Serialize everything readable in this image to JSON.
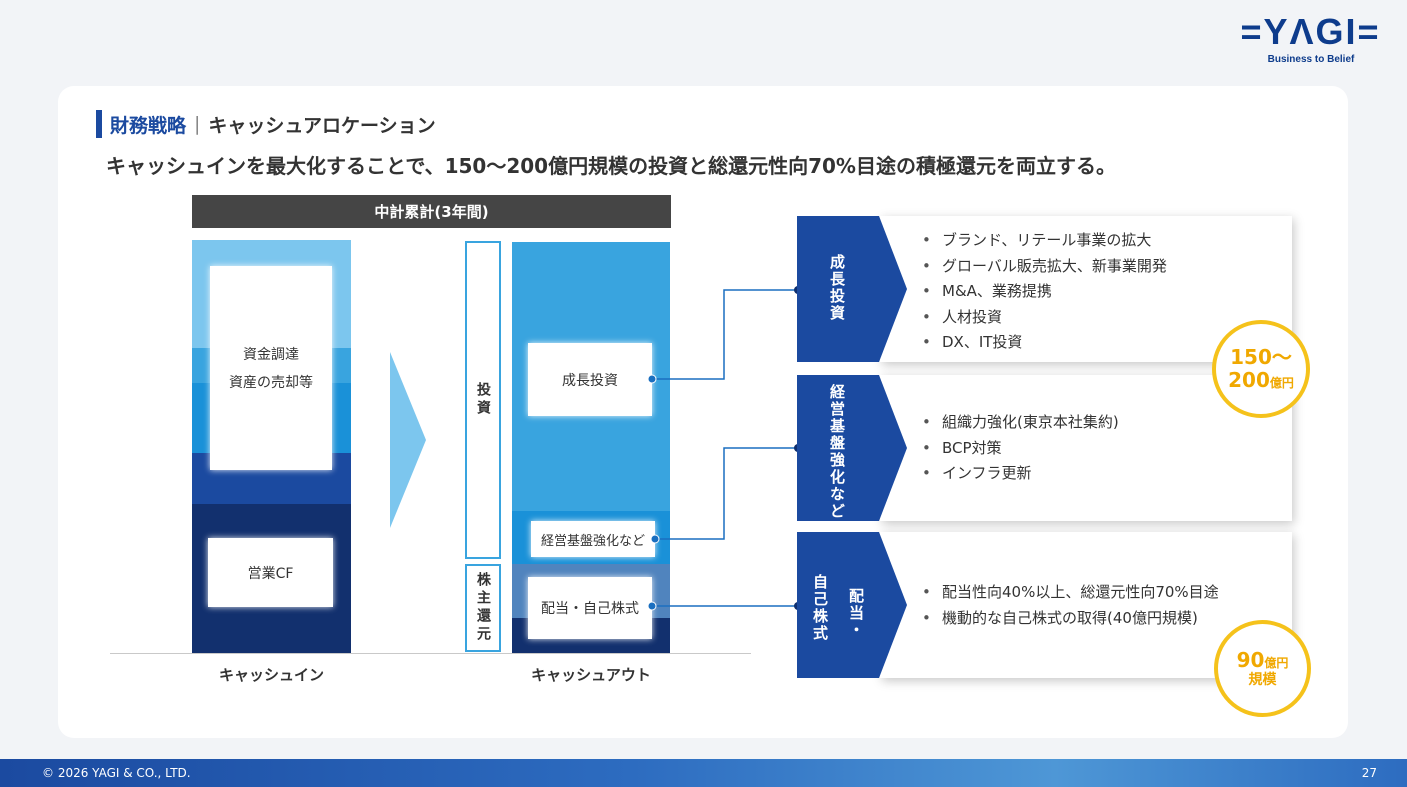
{
  "logo": {
    "word": "=YΛGI=",
    "tagline": "Business to Belief"
  },
  "section": {
    "title": "財務戦略",
    "subtitle": "キャッシュアロケーション"
  },
  "headline": "キャッシュインを最大化することで、150～200億円規模の投資と総還元性向70%目途の積極還元を両立する。",
  "diagram": {
    "header": "中計累計(3年間)",
    "cash_in": {
      "funding_label_1": "資金調達",
      "funding_label_2": "資産の売却等",
      "operating_cf": "営業CF",
      "axis_label": "キャッシュイン"
    },
    "cash_out": {
      "growth": "成長投資",
      "foundation": "経営基盤強化など",
      "returns": "配当・自己株式",
      "axis_label": "キャッシュアウト"
    },
    "brackets": {
      "investment": "投資",
      "shareholder_return": "株主還元"
    }
  },
  "panels": [
    {
      "heading": "成長投資",
      "items": [
        "ブランド、リテール事業の拡大",
        "グローバル販売拡大、新事業開発",
        "M&A、業務提携",
        "人材投資",
        "DX、IT投資"
      ]
    },
    {
      "heading": "経営基盤強化など",
      "items": [
        "組織力強化(東京本社集約)",
        "BCP対策",
        "インフラ更新"
      ]
    },
    {
      "heading_col1": "配当・",
      "heading_col2": "自己株式",
      "items": [
        "配当性向40%以上、総還元性向70%目途",
        "機動的な自己株式の取得(40億円規模)"
      ]
    }
  ],
  "badges": {
    "growth": {
      "line1": "150～",
      "line2_num": "200",
      "line2_unit": "億円"
    },
    "returns": {
      "line1_num": "90",
      "line1_unit": "億円",
      "line2": "規模"
    }
  },
  "footer": {
    "copyright": "© 2026 YAGI & CO., LTD.",
    "page": "27"
  },
  "colors": {
    "navy": "#0e3c8c",
    "chevron": "#1b4aa0",
    "light_blue": "#7cc6ee",
    "mid_blue": "#39a4df",
    "bright_blue": "#1a91d8",
    "dark_navy": "#12306e",
    "badge_gold": "#f5c21b",
    "header_gray": "#454545"
  }
}
